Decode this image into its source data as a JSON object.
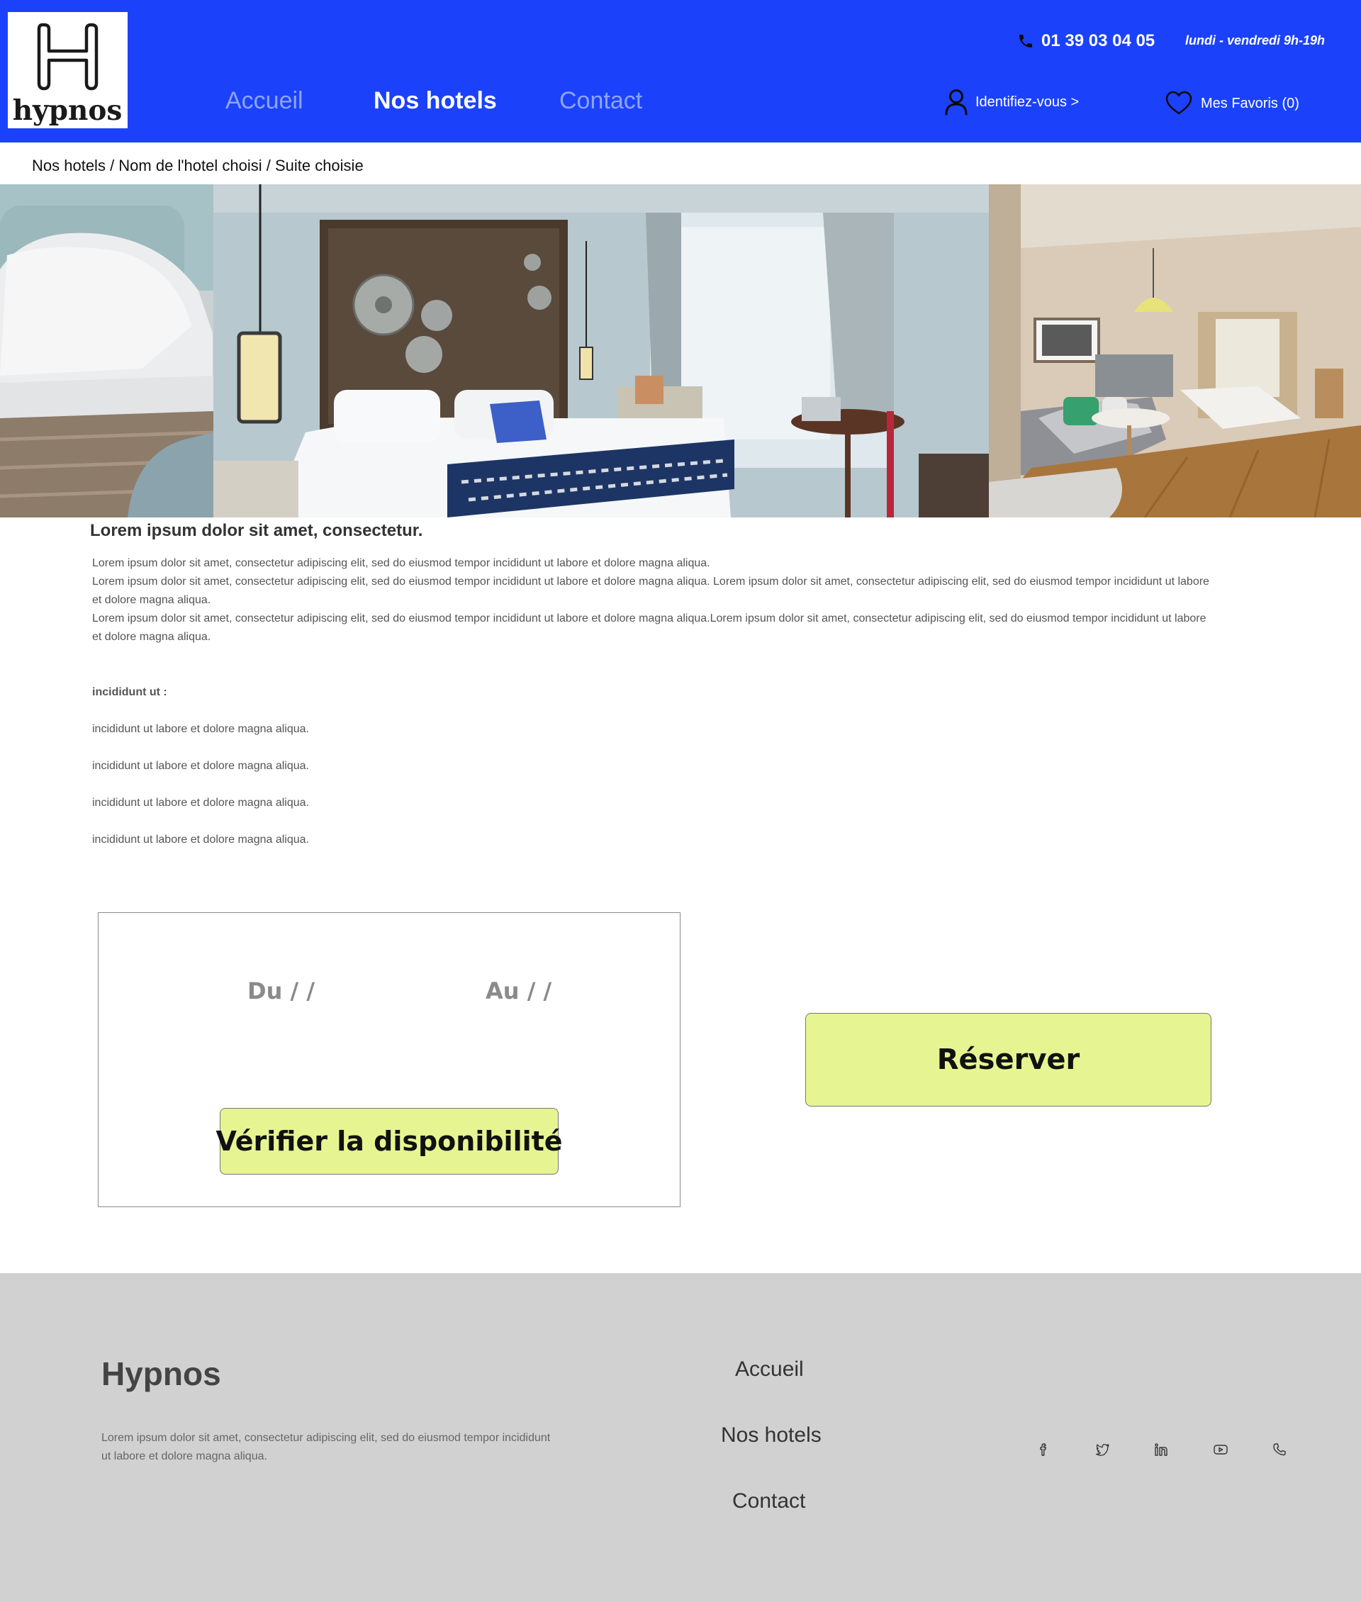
{
  "header": {
    "logo_text": "hypnos",
    "nav": [
      {
        "label": "Accueil"
      },
      {
        "label": "Nos hotels"
      },
      {
        "label": "Contact"
      }
    ],
    "phone": "01 39 03 04 05",
    "hours": "lundi - vendredi 9h-19h",
    "login_label": "Identifiez-vous >",
    "favorites_label": "Mes Favoris (0)",
    "colors": {
      "background": "#1b42fa",
      "nav_inactive": "#8ea4fb",
      "text": "#ffffff"
    }
  },
  "breadcrumb": [
    "Nos hotels",
    "Nom de l'hotel choisi",
    "Suite choisie"
  ],
  "content": {
    "title": "Lorem ipsum dolor sit amet, consectetur.",
    "paragraphs": [
      "Lorem ipsum dolor sit amet, consectetur adipiscing elit, sed do eiusmod tempor incididunt ut labore et dolore magna aliqua.",
      "Lorem ipsum dolor sit amet, consectetur adipiscing elit, sed do eiusmod tempor incididunt ut labore et dolore magna aliqua. Lorem ipsum dolor sit amet, consectetur adipiscing elit, sed do eiusmod tempor incididunt ut labore et dolore magna aliqua.",
      "Lorem ipsum dolor sit amet, consectetur adipiscing elit, sed do eiusmod tempor incididunt ut labore et dolore magna aliqua.Lorem ipsum dolor sit amet, consectetur adipiscing elit, sed do eiusmod tempor incididunt ut labore et dolore magna aliqua."
    ],
    "list_title": "incididunt ut :",
    "list": [
      "incididunt ut labore et dolore magna aliqua.",
      "incididunt ut labore et dolore magna aliqua.",
      "incididunt ut labore et dolore magna aliqua.",
      "incididunt ut labore et dolore magna aliqua."
    ]
  },
  "booking": {
    "from_label": "Du  /   /",
    "to_label": "Au  /   /",
    "check_button": "Vérifier la disponibilité",
    "reserve_button": "Réserver",
    "button_color": "#e6f591"
  },
  "footer": {
    "brand": "Hypnos",
    "description": "Lorem ipsum dolor sit amet, consectetur adipiscing elit, sed do eiusmod tempor incididunt ut labore et dolore magna aliqua.",
    "links": [
      "Accueil",
      "Nos hotels",
      "Contact"
    ],
    "social_icons": [
      "facebook-icon",
      "twitter-icon",
      "linkedin-icon",
      "youtube-icon",
      "phone-icon"
    ],
    "background": "#d1d1d1"
  }
}
